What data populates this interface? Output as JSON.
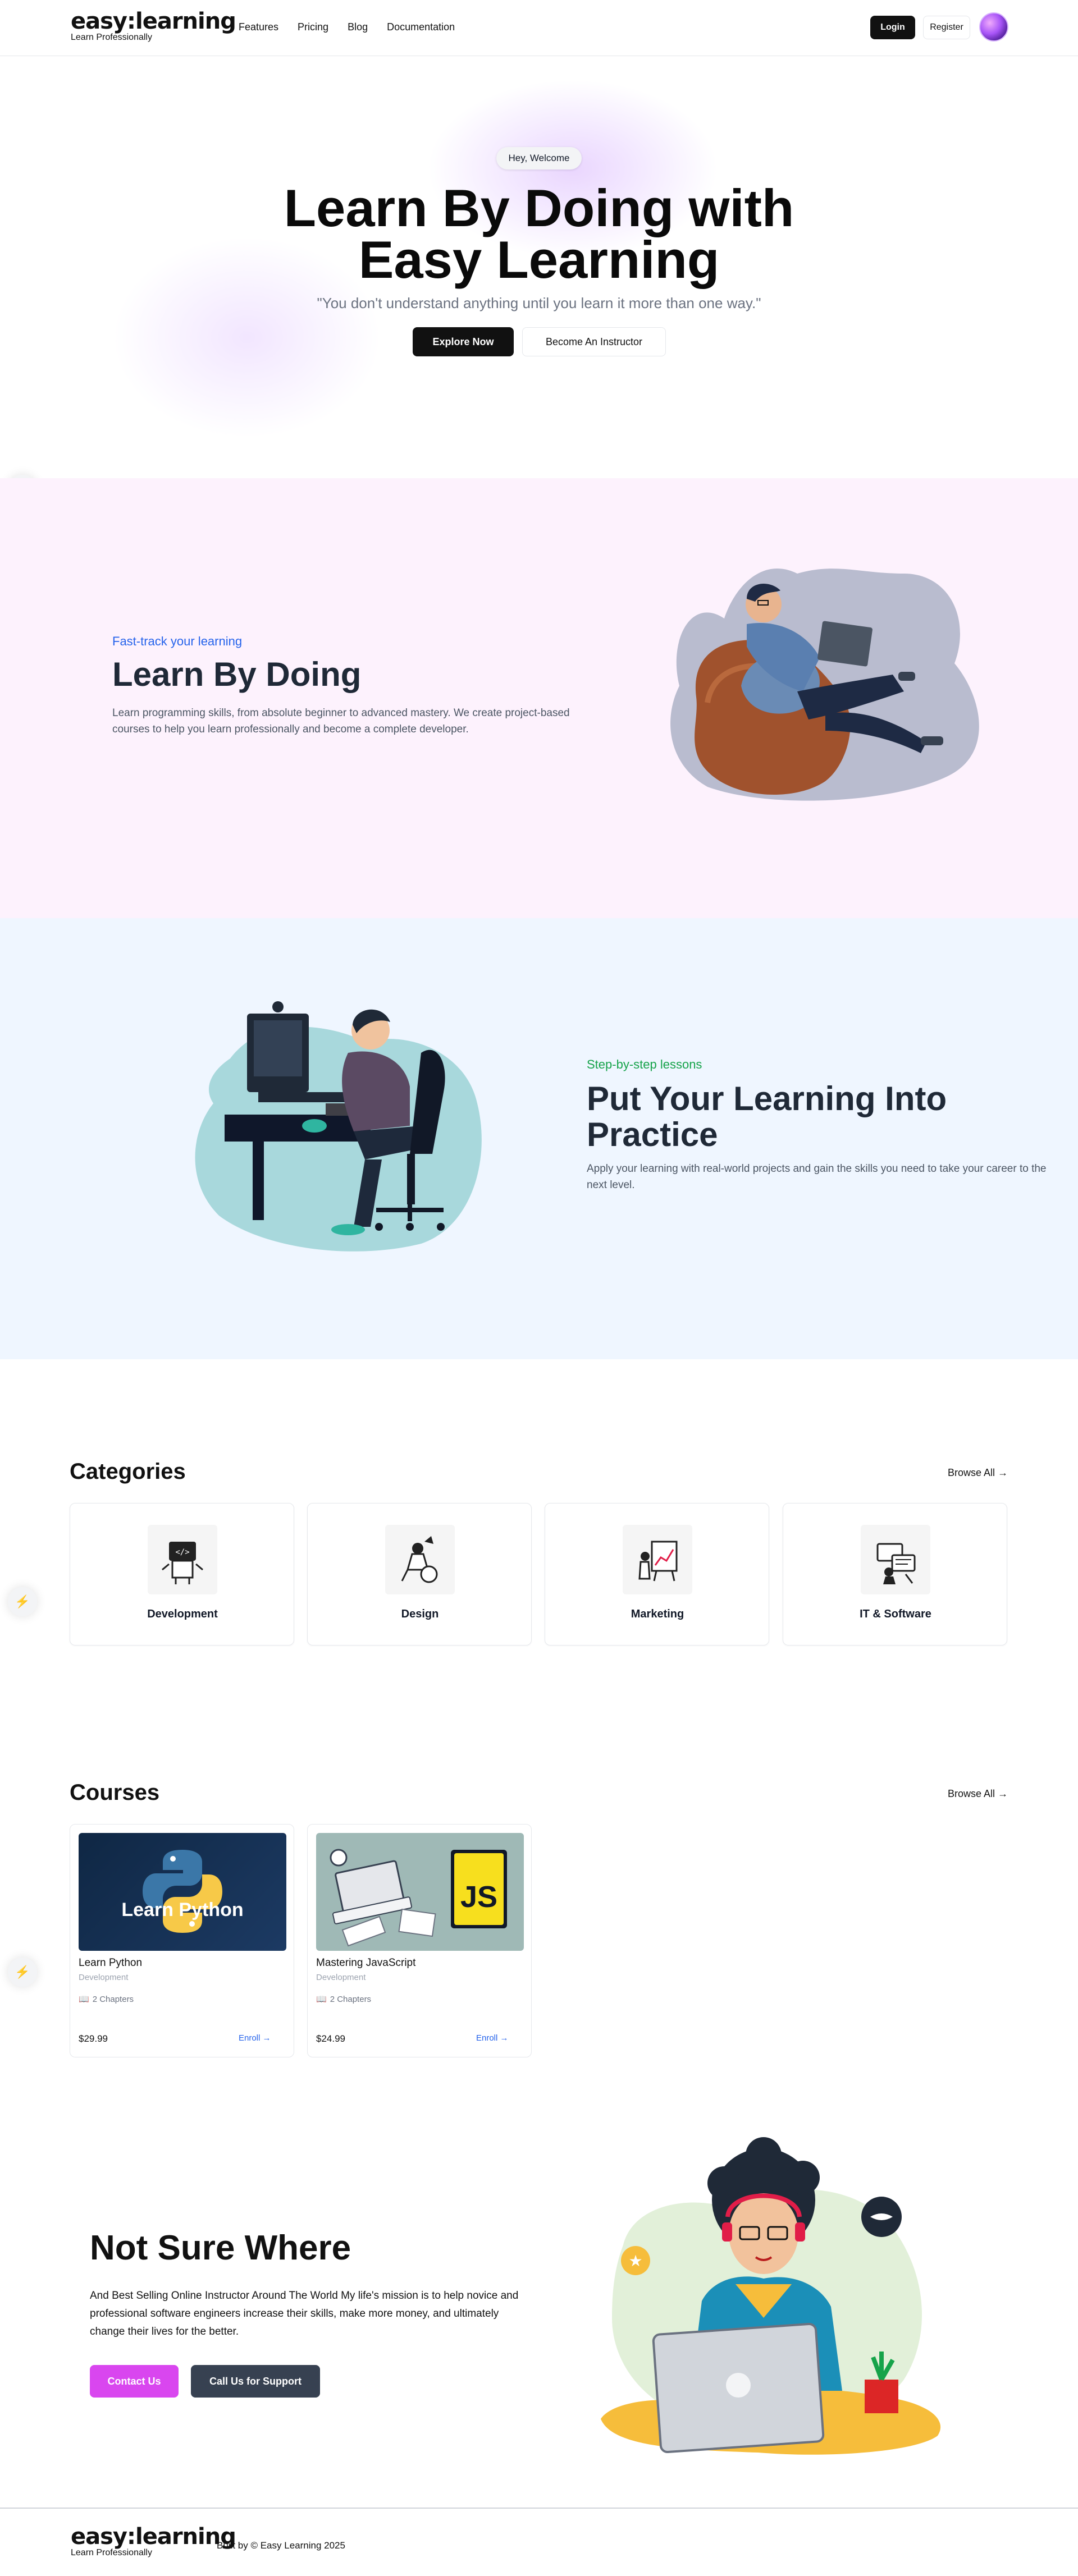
{
  "header": {
    "logo_main": "easy:learning",
    "logo_sub": "Learn Professionally",
    "nav": [
      "Features",
      "Pricing",
      "Blog",
      "Documentation"
    ],
    "login_label": "Login",
    "register_label": "Register"
  },
  "hero": {
    "badge": "Hey, Welcome",
    "title_line1": "Learn By Doing with",
    "title_line2": "Easy Learning",
    "quote": "\"You don't understand anything until you learn it more than one way.\"",
    "explore_label": "Explore Now",
    "instructor_label": "Become An Instructor"
  },
  "section1": {
    "kicker": "Fast-track your learning",
    "title": "Learn By Doing",
    "text": "Learn programming skills, from absolute beginner to advanced mastery. We create project-based courses to help you learn professionally and become a complete developer."
  },
  "section2": {
    "kicker": "Step-by-step lessons",
    "title": "Put Your Learning Into Practice",
    "text": "Apply your learning with real-world projects and gain the skills you need to take your career to the next level."
  },
  "categories": {
    "title": "Categories",
    "browse_all": "Browse All",
    "items": [
      "Development",
      "Design",
      "Marketing",
      "IT & Software"
    ]
  },
  "courses": {
    "title": "Courses",
    "browse_all": "Browse All",
    "items": [
      {
        "thumb_text": "Learn Python",
        "title": "Learn Python",
        "category": "Development",
        "chapters": "2 Chapters",
        "price": "$29.99",
        "enroll": "Enroll"
      },
      {
        "thumb_text": "JS",
        "title": "Mastering JavaScript",
        "category": "Development",
        "chapters": "2 Chapters",
        "price": "$24.99",
        "enroll": "Enroll"
      }
    ]
  },
  "not_sure": {
    "title": "Not Sure Where",
    "text": "And Best Selling Online Instructor Around The World My life's mission is to help novice and professional software engineers increase their skills, make more money, and ultimately change their lives for the better.",
    "contact_label": "Contact Us",
    "support_label": "Call Us for Support"
  },
  "footer": {
    "logo_main": "easy:learning",
    "logo_sub": "Learn Professionally",
    "copyright": "Built by © Easy Learning 2025"
  },
  "colors": {
    "accent_pink": "#d946ef",
    "section1_bg": "#fdf2fd",
    "section2_bg": "#eff6ff",
    "kicker_blue": "#2563eb",
    "kicker_green": "#16a34a"
  },
  "icons": [
    "lightning-icon",
    "arrow-right-icon",
    "book-icon",
    "avatar"
  ]
}
